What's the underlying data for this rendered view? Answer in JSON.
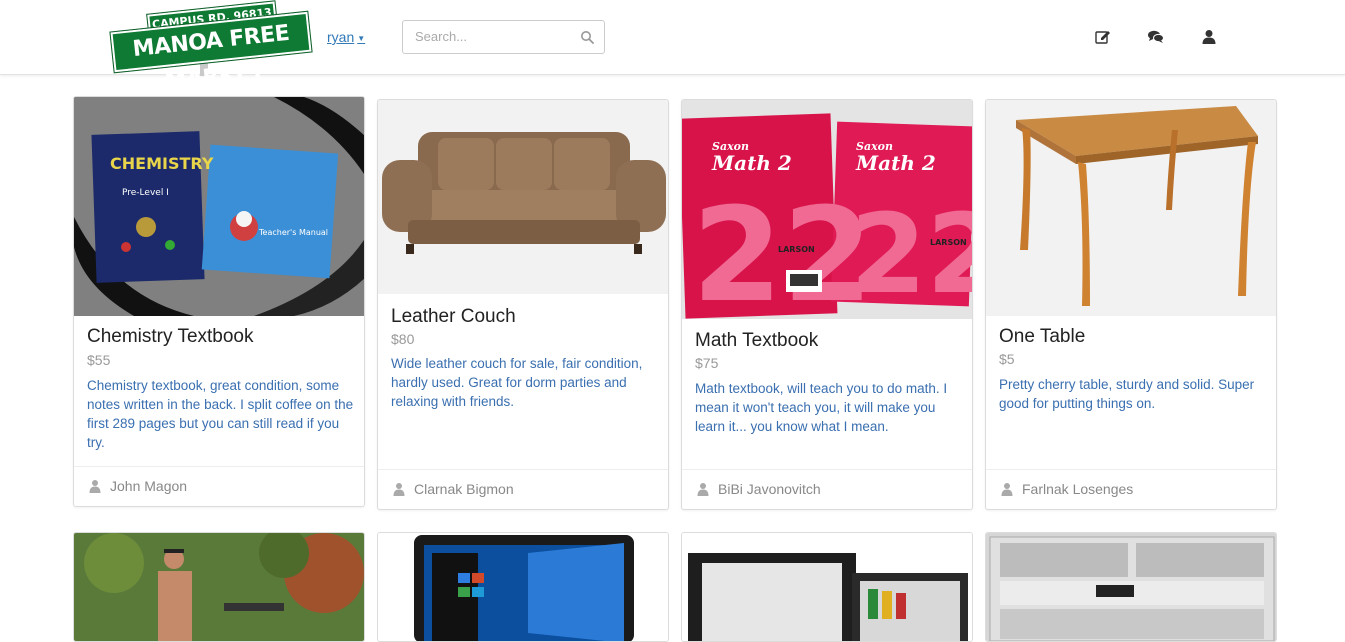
{
  "logo": {
    "top_sign": "CAMPUS RD. 96813 ▸",
    "main_sign": "MANOA FREE MARKET"
  },
  "nav": {
    "user_name": "ryan",
    "search_placeholder": "Search..."
  },
  "nav_icons": [
    "edit-icon",
    "chat-icon",
    "user-icon"
  ],
  "listings": [
    {
      "title": "Chemistry Textbook",
      "price": "$55",
      "description": "Chemistry textbook, great condition, some notes written in the back. I split coffee on the first 289 pages but you can still read if you try.",
      "seller": "John Magon",
      "image": "chemistry-books"
    },
    {
      "title": "Leather Couch",
      "price": "$80",
      "description": "Wide leather couch for sale, fair condition, hardly used. Great for dorm parties and relaxing with friends.",
      "seller": "Clarnak Bigmon",
      "image": "brown-couch"
    },
    {
      "title": "Math Textbook",
      "price": "$75",
      "description": "Math textbook, will teach you to do math. I mean it won't teach you, it will make you learn it... you know what I mean.",
      "seller": "BiBi Javonovitch",
      "image": "saxon-math-books"
    },
    {
      "title": "One Table",
      "price": "$5",
      "description": "Pretty cherry table, sturdy and solid. Super good for putting things on.",
      "seller": "Farlnak Losenges",
      "image": "cherry-table"
    }
  ],
  "book_texts": {
    "chem_cover": "CHEMISTRY",
    "chem_level": "Pre-Level I",
    "chem_manual": "Teacher's Manual",
    "math_brand": "Saxon",
    "math_title": "Math 2",
    "math_publisher": "LARSON"
  },
  "colors": {
    "accent": "#337ab7",
    "description": "#3a6fb0",
    "logo_green": "#0f7a33"
  }
}
